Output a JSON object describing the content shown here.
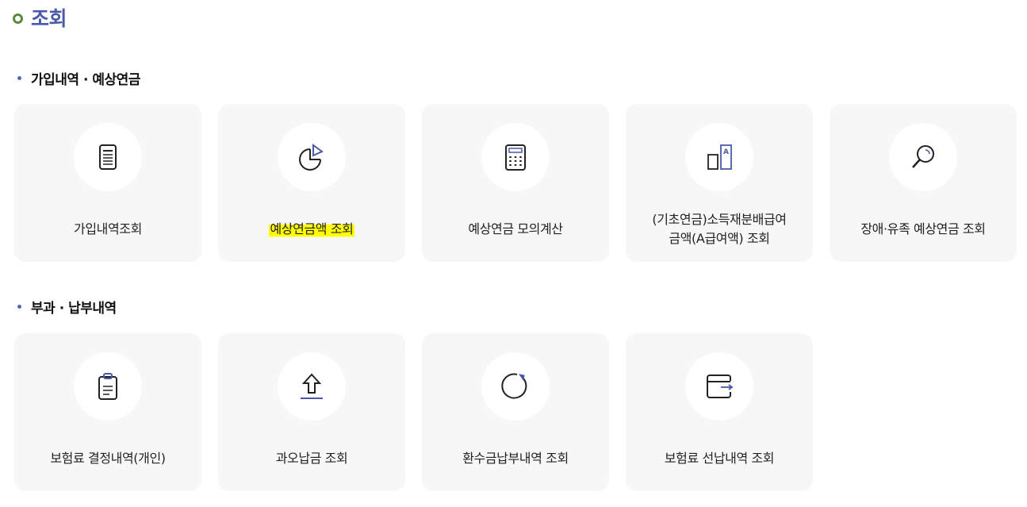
{
  "page": {
    "title": "조회"
  },
  "sections": [
    {
      "heading": "가입내역 · 예상연금",
      "cards": [
        {
          "label": "가입내역조회",
          "icon": "document-icon"
        },
        {
          "label": "예상연금액 조회",
          "icon": "pie-chart-icon",
          "highlighted": true
        },
        {
          "label": "예상연금 모의계산",
          "icon": "calculator-icon"
        },
        {
          "label": "(기초연금)소득재분배급여\n금액(A급여액) 조회",
          "icon": "bar-a-icon"
        },
        {
          "label": "장애·유족 예상연금 조회",
          "icon": "magnifier-icon"
        }
      ]
    },
    {
      "heading": "부과 · 납부내역",
      "cards": [
        {
          "label": "보험료 결정내역(개인)",
          "icon": "clipboard-icon"
        },
        {
          "label": "과오납금 조회",
          "icon": "upload-arrow-icon"
        },
        {
          "label": "환수금납부내역 조회",
          "icon": "refresh-icon"
        },
        {
          "label": "보험료 선납내역 조회",
          "icon": "wallet-icon"
        }
      ]
    }
  ],
  "colors": {
    "title": "#4a5aa8",
    "accent": "#5b64ae",
    "highlight": "#ffff00",
    "card_bg": "#f7f7f7"
  }
}
